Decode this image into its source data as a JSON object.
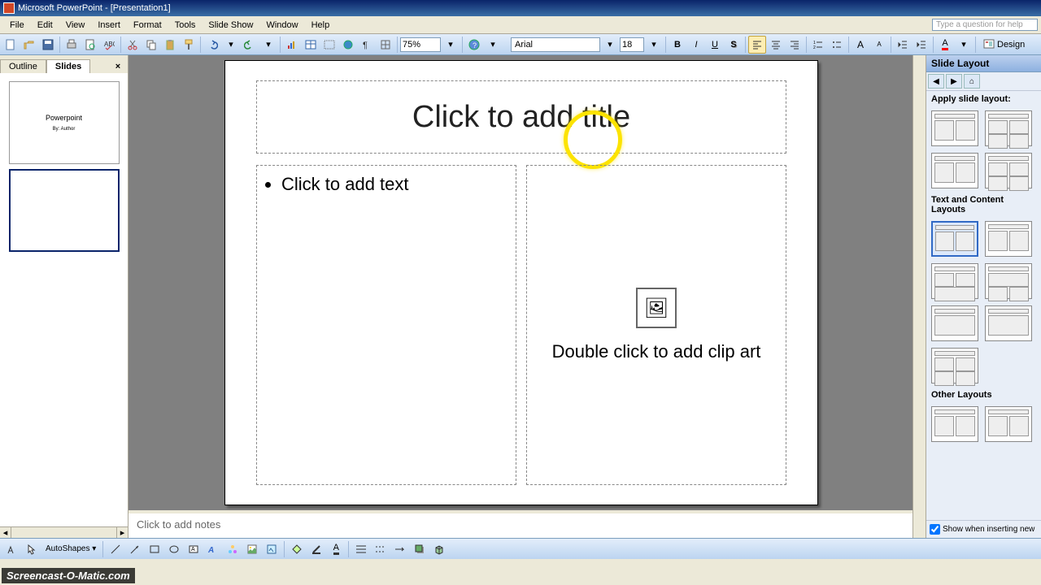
{
  "title_bar": {
    "app_title": "Microsoft PowerPoint - [Presentation1]"
  },
  "menu": {
    "file": "File",
    "edit": "Edit",
    "view": "View",
    "insert": "Insert",
    "format": "Format",
    "tools": "Tools",
    "slideshow": "Slide Show",
    "window": "Window",
    "help": "Help",
    "help_placeholder": "Type a question for help"
  },
  "toolbar": {
    "zoom": "75%",
    "font": "Arial",
    "font_size": "18",
    "design": "Design"
  },
  "left_panel": {
    "tab_outline": "Outline",
    "tab_slides": "Slides",
    "thumb1_title": "Powerpoint",
    "thumb1_sub": "By: Author"
  },
  "slide": {
    "title_placeholder": "Click to add title",
    "text_placeholder": "Click to add text",
    "clipart_placeholder": "Double click to add clip art"
  },
  "notes": {
    "placeholder": "Click to add notes"
  },
  "task_pane": {
    "title": "Slide Layout",
    "apply_label": "Apply slide layout:",
    "section_text_content": "Text and Content Layouts",
    "section_other": "Other Layouts",
    "show_checkbox": "Show when inserting new"
  },
  "watermark": "Screencast-O-Matic.com"
}
